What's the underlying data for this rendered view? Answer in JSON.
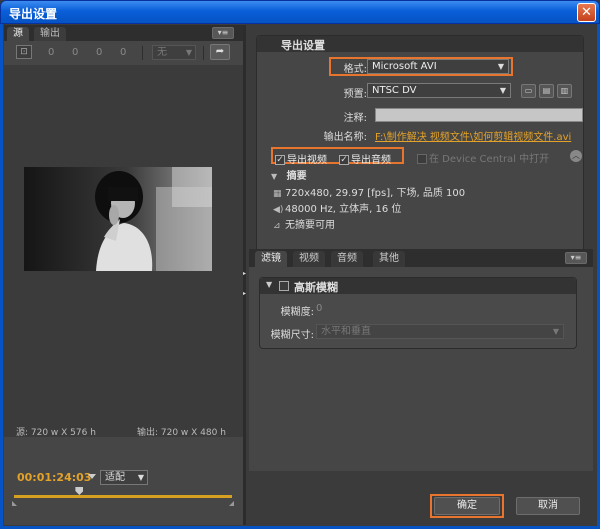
{
  "window": {
    "title": "导出设置",
    "close_glyph": "✕"
  },
  "left_panel": {
    "tabs": [
      "源",
      "输出"
    ],
    "menu_glyph": "▾≡",
    "toolbar": {
      "crop_glyph": "⊡",
      "crop_values": [
        "0",
        "0",
        "0",
        "0"
      ],
      "ratio_select": "无",
      "rotate_glyph": "➦"
    },
    "source_dims": "源: 720 w X 576 h",
    "output_dims": "输出: 720 w X 480 h",
    "timecode": "00:01:24:03",
    "fit_select": "适配",
    "playhead_position_fraction": 0.3
  },
  "export_settings": {
    "section_title": "导出设置",
    "format_label": "格式:",
    "format_value": "Microsoft AVI",
    "preset_label": "预置:",
    "preset_value": "NTSC DV",
    "preset_icons": [
      "save-preset-icon",
      "import-preset-icon",
      "delete-preset-icon"
    ],
    "comment_label": "注释:",
    "comment_value": "",
    "output_name_label": "输出名称:",
    "output_name_value": "F:\\制作解决 视频文件\\如何剪辑视频文件.avi",
    "export_video_label": "导出视频",
    "export_audio_label": "导出音频",
    "export_video_checked": true,
    "export_audio_checked": true,
    "device_central_label": "在 Device Central 中打开",
    "summary_title": "摘要",
    "summary_video": "720x480, 29.97 [fps], 下场, 品质 100",
    "summary_audio": "48000 Hz, 立体声, 16 位",
    "summary_misc": "无摘要可用"
  },
  "effects": {
    "tabs": [
      "滤镜",
      "视频",
      "音频",
      "其他"
    ],
    "menu_glyph": "▾≡",
    "blur_title": "高斯模糊",
    "blur_amount_label": "模糊度:",
    "blur_amount_value": "0",
    "blur_dimension_label": "模糊尺寸:",
    "blur_dimension_value": "水平和垂直"
  },
  "buttons": {
    "ok": "确定",
    "cancel": "取消"
  },
  "colors": {
    "accent_orange": "#e8752d",
    "timecode": "#e3a22a",
    "titlebar": "#0a5fd8"
  }
}
